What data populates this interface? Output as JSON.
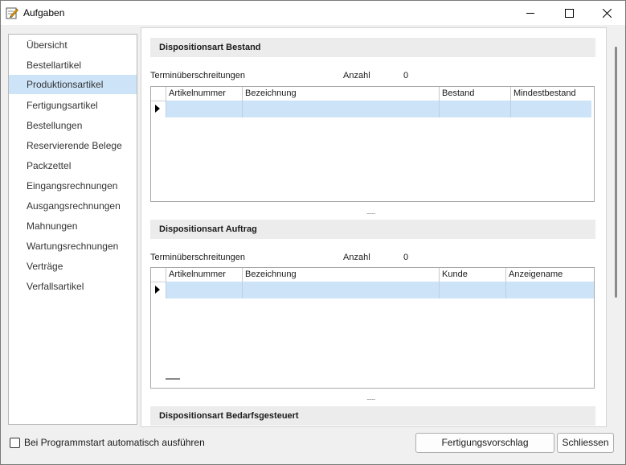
{
  "window": {
    "title": "Aufgaben"
  },
  "nav": {
    "items": [
      {
        "label": "Übersicht"
      },
      {
        "label": "Bestellartikel"
      },
      {
        "label": "Produktionsartikel",
        "selected": true
      },
      {
        "label": "Fertigungsartikel"
      },
      {
        "label": "Bestellungen"
      },
      {
        "label": "Reservierende Belege"
      },
      {
        "label": "Packzettel"
      },
      {
        "label": "Eingangsrechnungen"
      },
      {
        "label": "Ausgangsrechnungen"
      },
      {
        "label": "Mahnungen"
      },
      {
        "label": "Wartungsrechnungen"
      },
      {
        "label": "Verträge"
      },
      {
        "label": "Verfallsartikel"
      }
    ]
  },
  "sections": {
    "bestand": {
      "title": "Dispositionsart Bestand",
      "overdue_label": "Terminüberschreitungen",
      "count_label": "Anzahl",
      "count_value": "0",
      "columns": [
        "Artikelnummer",
        "Bezeichnung",
        "Bestand",
        "Mindestbestand"
      ]
    },
    "auftrag": {
      "title": "Dispositionsart Auftrag",
      "overdue_label": "Terminüberschreitungen",
      "count_label": "Anzahl",
      "count_value": "0",
      "columns": [
        "Artikelnummer",
        "Bezeichnung",
        "Kunde",
        "Anzeigename"
      ]
    },
    "bedarf": {
      "title": "Dispositionsart Bedarfsgesteuert"
    }
  },
  "footer": {
    "autostart_label": "Bei Programmstart automatisch ausführen",
    "autostart_checked": false,
    "proposal_button": "Fertigungsvorschlag",
    "close_button": "Schliessen"
  }
}
